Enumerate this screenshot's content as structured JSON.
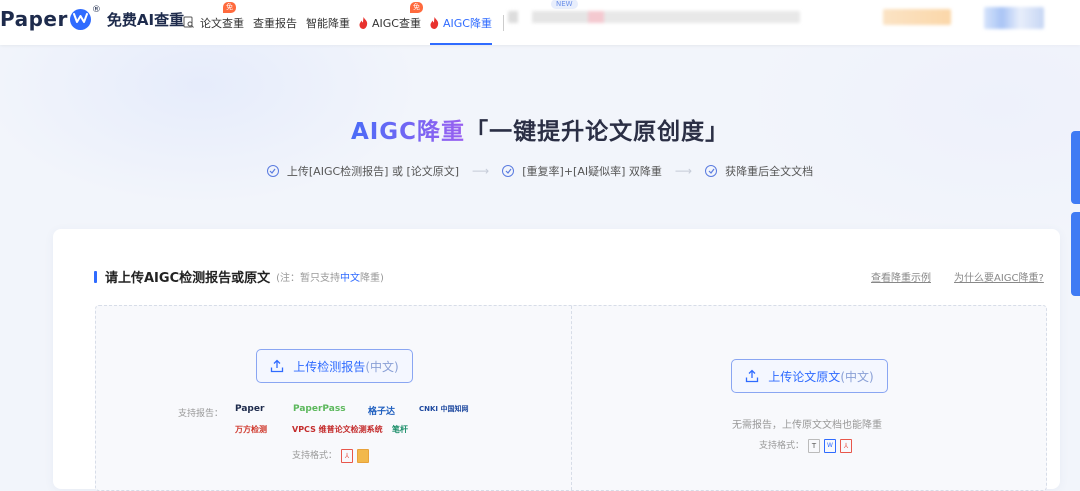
{
  "header": {
    "logo": {
      "text": "Paper",
      "suffix": "®",
      "free_label": "免费AI查重"
    },
    "nav": [
      {
        "label": "论文查重",
        "badge": "免",
        "icon": "doc-search-icon"
      },
      {
        "label": "查重报告"
      },
      {
        "label": "智能降重"
      },
      {
        "label": "AIGC查重",
        "badge": "免",
        "icon": "flame-icon"
      },
      {
        "label": "AIGC降重",
        "icon": "flame-icon",
        "active": true
      }
    ],
    "new_badge": "NEW"
  },
  "hero": {
    "title_accent": "AIGC降重",
    "title_rest": "「一键提升论文原创度」",
    "steps": [
      "上传[AIGC检测报告] 或 [论文原文]",
      "[重复率]+[AI疑似率] 双降重",
      "获降重后全文文档"
    ]
  },
  "upload": {
    "title": "请上传AIGC检测报告或原文",
    "note_prefix": "(注：暂只支持",
    "note_highlight": "中文",
    "note_suffix": "降重)",
    "link_example": "查看降重示例",
    "link_why": "为什么要AIGC降重?",
    "left": {
      "button_label": "上传检测报告",
      "button_suffix": "(中文)",
      "support_label": "支持报告：",
      "brands": [
        "Paper",
        "PaperPass",
        "格子达",
        "CNKI 中国知网",
        "万方检测",
        "VPCS 维普论文检测系统",
        "笔杆"
      ],
      "format_label": "支持格式："
    },
    "right": {
      "button_label": "上传论文原文",
      "button_suffix": "(中文)",
      "hint": "无需报告，上传原文文档也能降重",
      "format_label": "支持格式：",
      "formats": [
        "T",
        "W",
        "PDF"
      ]
    }
  },
  "colors": {
    "accent": "#2f6bff",
    "title_gradient_start": "#4a6cf7",
    "title_gradient_end": "#9a5ff0"
  }
}
